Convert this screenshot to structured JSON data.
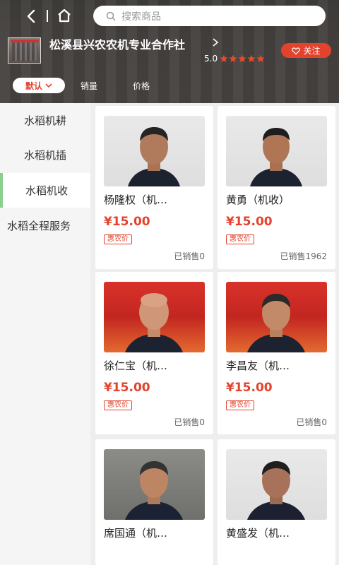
{
  "search": {
    "placeholder": "搜索商品"
  },
  "shop": {
    "name": "松溪县兴农农机专业合作社",
    "rating": "5.0",
    "stars": 5,
    "follow_label": "关注"
  },
  "sort_tabs": {
    "default": "默认",
    "sales": "销量",
    "price": "价格"
  },
  "categories": [
    {
      "label": "水稻机耕",
      "active": false
    },
    {
      "label": "水稻机插",
      "active": false
    },
    {
      "label": "水稻机收",
      "active": true
    },
    {
      "label": "水稻全程服务",
      "active": false
    }
  ],
  "products": [
    {
      "name": "杨隆权（机…",
      "price": "¥15.00",
      "tag": "惠农价",
      "sold": "已销售0",
      "photo": "plain-background-portrait"
    },
    {
      "name": "黄勇（机收）",
      "price": "¥15.00",
      "tag": "惠农价",
      "sold": "已销售1962",
      "photo": "plain-background-portrait"
    },
    {
      "name": "徐仁宝（机…",
      "price": "¥15.00",
      "tag": "惠农价",
      "sold": "已销售0",
      "photo": "red-flag-background-portrait"
    },
    {
      "name": "李昌友（机…",
      "price": "¥15.00",
      "tag": "惠农价",
      "sold": "已销售0",
      "photo": "red-flag-background-portrait"
    },
    {
      "name": "席国通（机…",
      "price": "",
      "tag": "",
      "sold": "",
      "photo": "wall-background-portrait"
    },
    {
      "name": "黄盛发（机…",
      "price": "",
      "tag": "",
      "sold": "",
      "photo": "plain-background-portrait"
    }
  ],
  "colors": {
    "accent": "#e3432d",
    "active_category": "#8ccf8c"
  }
}
